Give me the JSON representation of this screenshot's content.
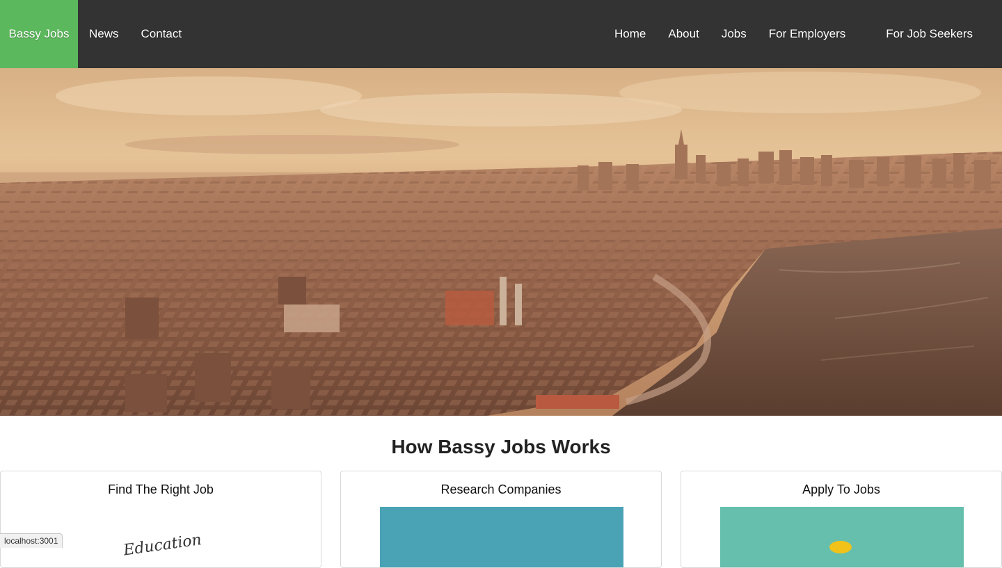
{
  "navbar": {
    "brand": "Bassy Jobs",
    "left_links": [
      "News",
      "Contact"
    ],
    "right_links": [
      "Home",
      "About",
      "Jobs",
      "For Employers",
      "For Job Seekers"
    ],
    "colors": {
      "background": "#333333",
      "brand_background": "#5cb85c"
    }
  },
  "hero": {
    "image": "aerial-city-skyline-photo"
  },
  "how_it_works": {
    "title": "How Bassy Jobs Works",
    "cards": [
      {
        "title": "Find The Right Job",
        "image_text": "Education",
        "image_color": "#ffffff"
      },
      {
        "title": "Research Companies",
        "image_color": "#4aa3b5"
      },
      {
        "title": "Apply To Jobs",
        "image_color": "#66bfad"
      }
    ]
  },
  "status_bar": {
    "url": "localhost:3001"
  }
}
